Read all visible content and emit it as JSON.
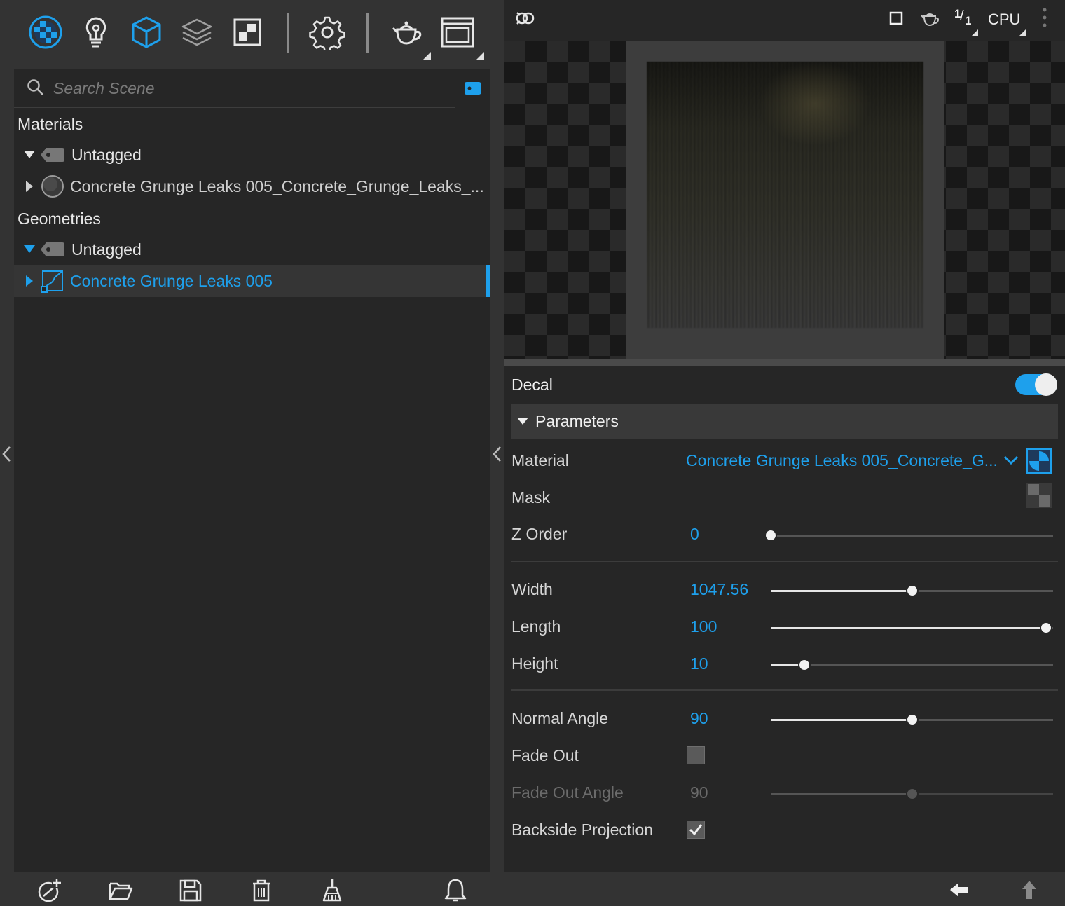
{
  "toolbar": {
    "icons": [
      "scene-icon",
      "light-icon",
      "geometry-icon",
      "layers-icon",
      "texture-icon",
      "settings-icon",
      "teapot-icon",
      "window-icon"
    ]
  },
  "scene": {
    "search": {
      "placeholder": "Search Scene",
      "value": ""
    },
    "materials": {
      "title": "Materials",
      "group_label": "Untagged",
      "items": [
        "Concrete Grunge Leaks 005_Concrete_Grunge_Leaks_..."
      ]
    },
    "geometries": {
      "title": "Geometries",
      "group_label": "Untagged",
      "items": [
        "Concrete Grunge Leaks 005"
      ]
    }
  },
  "viewport": {
    "ratio_label": "1/1",
    "ratio_num": "1",
    "ratio_den": "1",
    "renderer": "CPU"
  },
  "properties": {
    "section_title": "Decal",
    "decal_enabled": true,
    "group_title": "Parameters",
    "material": {
      "label": "Material",
      "value": "Concrete Grunge Leaks 005_Concrete_G..."
    },
    "mask": {
      "label": "Mask"
    },
    "z_order": {
      "label": "Z Order",
      "value": "0",
      "fraction": 0.0
    },
    "width": {
      "label": "Width",
      "value": "1047.56",
      "fraction": 0.5
    },
    "length": {
      "label": "Length",
      "value": "100",
      "fraction": 0.975
    },
    "height": {
      "label": "Height",
      "value": "10",
      "fraction": 0.12
    },
    "normal_angle": {
      "label": "Normal Angle",
      "value": "90",
      "fraction": 0.5
    },
    "fade_out": {
      "label": "Fade Out",
      "checked": false
    },
    "fade_out_angle": {
      "label": "Fade Out Angle",
      "value": "90",
      "fraction": 0.5
    },
    "backside_projection": {
      "label": "Backside Projection",
      "checked": true
    }
  },
  "colors": {
    "accent": "#1ea0ec",
    "panel": "#262626",
    "chrome": "#333333"
  }
}
